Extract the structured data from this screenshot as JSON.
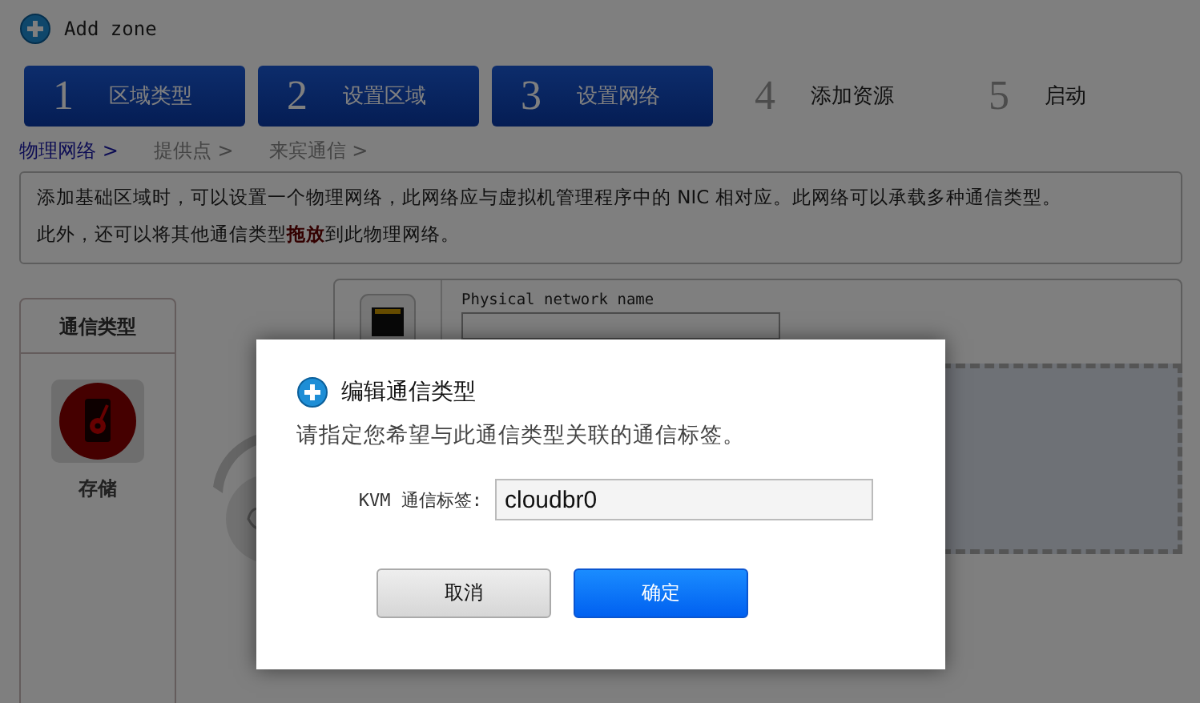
{
  "window": {
    "title": "Add zone"
  },
  "steps": [
    {
      "number": "1",
      "label": "区域类型",
      "selected": true
    },
    {
      "number": "2",
      "label": "设置区域",
      "selected": true
    },
    {
      "number": "3",
      "label": "设置网络",
      "selected": true
    },
    {
      "number": "4",
      "label": "添加资源",
      "selected": false
    },
    {
      "number": "5",
      "label": "启动",
      "selected": false
    }
  ],
  "breadcrumbs": [
    {
      "label": "物理网络 >",
      "selected": true
    },
    {
      "label": "提供点 >",
      "selected": false
    },
    {
      "label": "来宾通信 >",
      "selected": false
    }
  ],
  "info": [
    "添加基础区域时，可以设置一个物理网络，此网络应与虚拟机管理程序中的 NIC 相对应。此网络可以承载多种通信类型。",
    "此外，还可以将其他通信类型**拖放**到此物理网络。"
  ],
  "traffic_panel": {
    "title": "通信类型",
    "items": [
      {
        "label": "存储"
      }
    ]
  },
  "network": {
    "name_label": "Physical network name"
  },
  "dialog": {
    "title": "编辑通信类型",
    "description": "请指定您希望与此通信类型关联的通信标签。",
    "field_label": "KVM 通信标签:",
    "value": "cloudbr0",
    "buttons": [
      {
        "label": "取消",
        "kind": "secondary"
      },
      {
        "label": "确定",
        "kind": "primary"
      }
    ]
  }
}
